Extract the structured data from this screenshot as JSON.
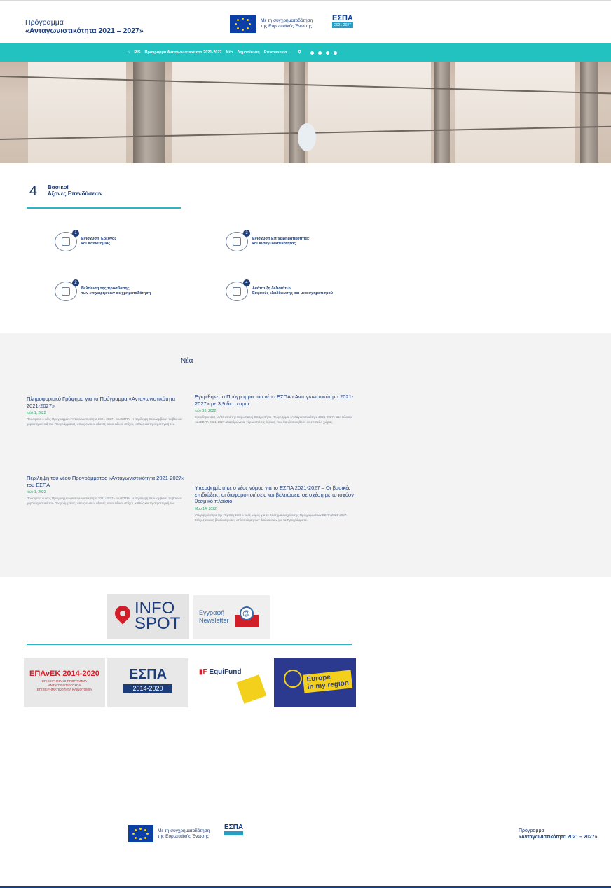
{
  "header": {
    "program_line1": "Πρόγραμμα",
    "program_line2": "«Ανταγωνιστικότητα 2021 – 2027»",
    "eu_line1": "Με τη συγχρηματοδότηση",
    "eu_line2": "της Ευρωπαϊκής Ένωσης",
    "espa_logo": "ΕΣΠΑ",
    "espa_years": "2021-2027"
  },
  "nav": {
    "items": [
      "RIS",
      "Πρόγραμμα Ανταγωνιστικότητα 2021-2027",
      "Νέα",
      "Δημοσίευση",
      "Επικοινωνία"
    ]
  },
  "axes": {
    "number": "4",
    "title_line1": "Βασικοί",
    "title_line2": "Άξονες Επενδύσεων",
    "items": [
      {
        "num": "1",
        "line1": "Ενίσχυση Έρευνας",
        "line2": "και Καινοτομίας"
      },
      {
        "num": "3",
        "line1": "Ενίσχυση Επιχειρηματικότητας",
        "line2": "και Ανταγωνιστικότητας"
      },
      {
        "num": "2",
        "line1": "Βελτίωση της πρόσβασης",
        "line2": "των επιχειρήσεων σε χρηματοδότηση"
      },
      {
        "num": "4",
        "line1": "Ανάπτυξη δεξιοτήτων",
        "line2": "Ευφυούς εξειδίκευσης και μετασχηματισμού"
      }
    ]
  },
  "news": {
    "heading": "Νέα",
    "items": [
      {
        "title": "Πληροφοριακό Γράφημα για το Πρόγραμμα «Ανταγωνιστικότητα 2021-2027»",
        "date": "Ιούλ 1, 2022",
        "body": "Πρόσφατα ο νέος Πρόγραμμα «Ανταγωνιστικότητα 2021-2027» του ΕΣΠΑ. Η περίληψη περιλαμβάνει τα βασικά χαρακτηριστικά του Προγράμματος, όπως είναι οι άξονες και οι ειδικοί στόχοι, καθώς και τη στρατηγική του."
      },
      {
        "title": "Εγκρίθηκε το Πρόγραμμα του νέου ΕΣΠΑ «Ανταγωνιστικότητα 2021-2027» με 3,9 δισ. ευρώ",
        "date": "Ιούν 16, 2022",
        "body": "Εγκρίθηκε στις 16/06 από την Ευρωπαϊκή Επιτροπή το Πρόγραμμα «Ανταγωνιστικότητα 2021-2027» στο πλαίσιο του ΕΣΠΑ 2021-2027. Διαρθρώνεται γύρω από τις άξονες, που θα υλοποιηθούν σε επίπεδο χώρας."
      },
      {
        "title": "Περίληψη του νέου Προγράμματος «Ανταγωνιστικότητα 2021-2027» του ΕΣΠΑ",
        "date": "Ιούν 1, 2022",
        "body": "Πρόσφατα ο νέος Πρόγραμμα «Ανταγωνιστικότητα 2021-2027» του ΕΣΠΑ. Η περίληψη περιλαμβάνει τα βασικά χαρακτηριστικά του Προγράμματος, όπως είναι οι άξονες και οι ειδικοί στόχοι, καθώς και τη στρατηγική του."
      },
      {
        "title": "Υπερψηφίστηκε ο νέος νόμος για το ΕΣΠΑ 2021-2027 – Οι βασικές επιδιώξεις, οι διαφοροποιήσεις και βελτιώσεις σε σχέση με το ισχύον θεσμικό πλαίσιο",
        "date": "Μαρ 14, 2022",
        "body": "Υπερψηφίστηκε την Πέμπτη 10/3 ο νέος νόμος για το Σύστημα Διαχείρισης Προγραμμάτων ΕΣΠΑ 2021-2027. Στόχος είναι η βελτίωση και η απλοποίηση των διαδικασιών για τα Προγράμματα."
      }
    ]
  },
  "banners": {
    "infospot_line1": "INFO",
    "infospot_line2": "SPOT",
    "newsletter_line1": "Εγγραφή",
    "newsletter_line2": "Newsletter",
    "epanek_title": "ΕΠΑνΕΚ 2014-2020",
    "epanek_sub": "ΕΠΙΧΕΙΡΗΣΙΑΚΟ ΠΡΟΓΡΑΜΜΑ ΑΝΤΑΓΩΝΙΣΤΙΚΟΤΗΤΑ ΕΠΙΧΕΙΡΗΜΑΤΙΚΟΤΗΤΑ ΚΑΙΝΟΤΟΜΙΑ",
    "espa2014_title": "ΕΣΠΑ",
    "espa2014_years": "2014-2020",
    "equifund": "EquiFund",
    "europe_line1": "Europe",
    "europe_line2": "in my region"
  },
  "footer": {
    "eu_line1": "Με τη συγχρηματοδότηση",
    "eu_line2": "της Ευρωπαϊκής Ένωσης",
    "espa_logo": "ΕΣΠΑ",
    "program_line1": "Πρόγραμμα",
    "program_line2": "«Ανταγωνιστικότητα 2021 – 2027»"
  },
  "colors": {
    "accent": "#21c2bf",
    "primary": "#1d3d7a",
    "date": "#27a86b"
  }
}
